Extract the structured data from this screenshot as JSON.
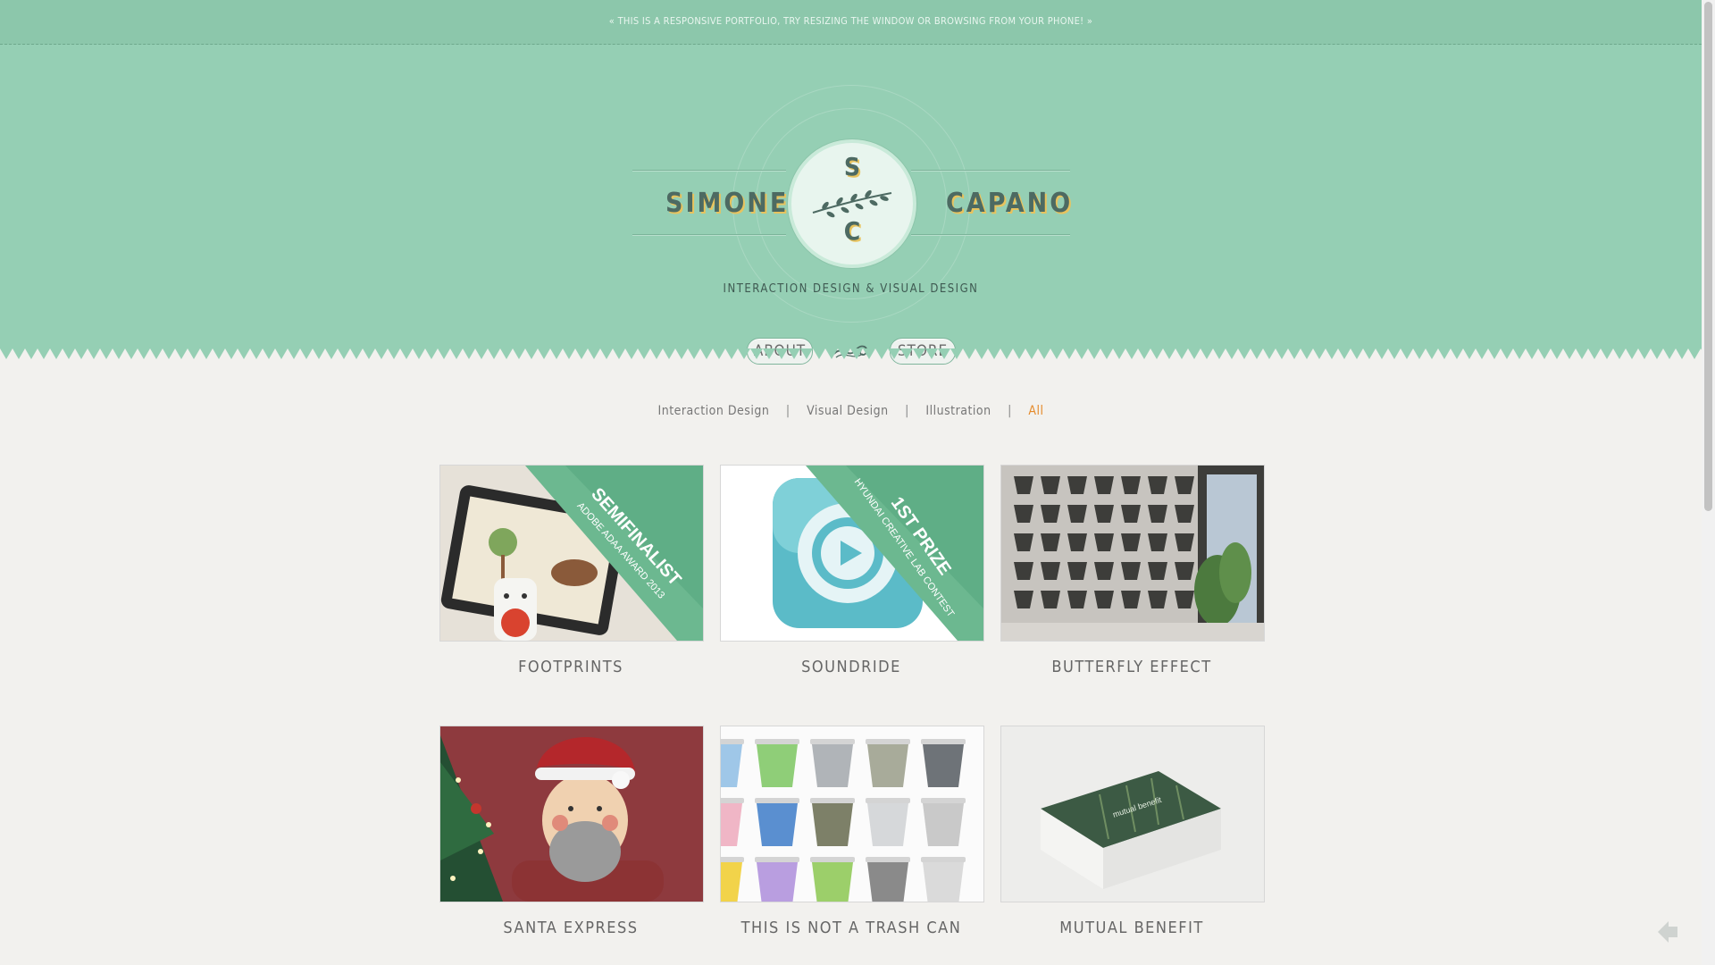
{
  "notice": {
    "text": "« THIS IS A RESPONSIVE PORTFOLIO, TRY RESIZING THE WINDOW OR BROWSING FROM YOUR PHONE! »"
  },
  "header": {
    "first_name": "SIMONE",
    "last_name": "CAPANO",
    "monogram_top": "S",
    "monogram_bottom": "C",
    "tagline": "INTERACTION DESIGN & VISUAL DESIGN",
    "nav": {
      "about": "ABOUT",
      "store": "STORE"
    }
  },
  "filters": {
    "items": [
      "Interaction Design",
      "Visual Design",
      "Illustration",
      "All"
    ],
    "separator": "|",
    "active": "All"
  },
  "projects": [
    {
      "title": "FOOTPRINTS",
      "ribbon": [
        "SEMIFINALIST",
        "ADOBE ADAA AWARD 2013"
      ]
    },
    {
      "title": "SOUNDRIDE",
      "ribbon": [
        "1ST PRIZE",
        "HYUNDAI CREATIVE LAB CONTEST"
      ]
    },
    {
      "title": "BUTTERFLY EFFECT"
    },
    {
      "title": "SANTA EXPRESS"
    },
    {
      "title": "THIS IS NOT A TRASH CAN"
    },
    {
      "title": "MUTUAL BENEFIT",
      "box_label": "mutual benefit"
    }
  ],
  "colors": {
    "header_green": "#95cfb4",
    "accent_orange": "#e58a2a",
    "name_shadow": "#e8c35e",
    "ribbon_green": "#5fae86"
  },
  "icons": {
    "back_to_top": "back-to-top-icon",
    "flourish": "flourish-icon",
    "branch": "branch-icon"
  }
}
